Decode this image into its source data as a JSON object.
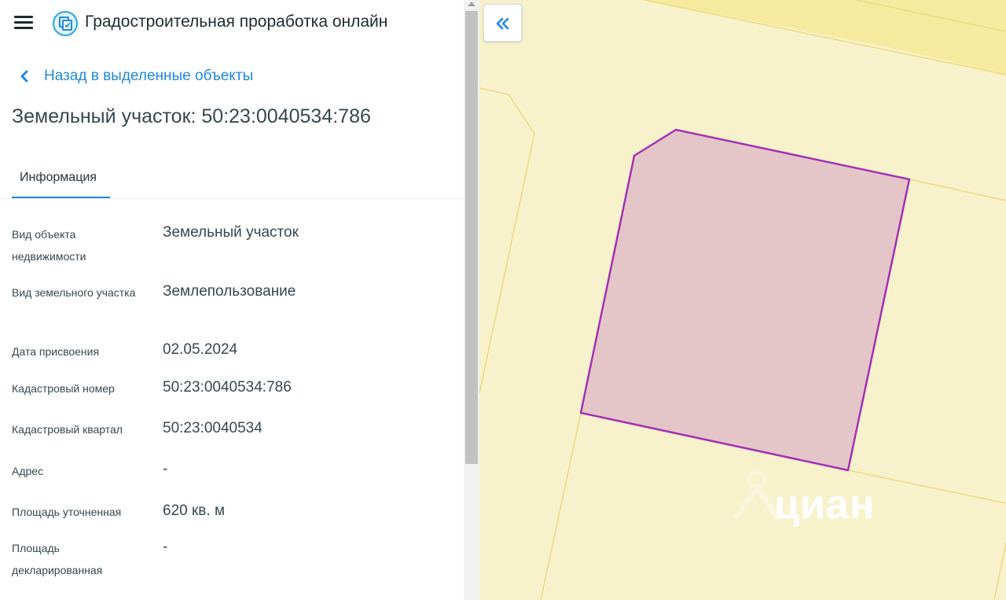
{
  "app": {
    "title": "Градостроительная проработка онлайн",
    "accent_color": "#1e88e5"
  },
  "nav": {
    "back_label": "Назад в выделенные объекты"
  },
  "page": {
    "title": "Земельный участок: 50:23:0040534:786"
  },
  "tabs": [
    {
      "label": "Информация",
      "active": true
    }
  ],
  "properties": [
    {
      "label": "Вид объекта недвижимости",
      "value": "Земельный участок"
    },
    {
      "label": "Вид земельного участка",
      "value": "Землепользование"
    },
    {
      "label": "Дата присвоения",
      "value": "02.05.2024"
    },
    {
      "label": "Кадастровый номер",
      "value": "50:23:0040534:786"
    },
    {
      "label": "Кадастровый квартал",
      "value": "50:23:0040534"
    },
    {
      "label": "Адрес",
      "value": "-"
    },
    {
      "label": "Площадь уточненная",
      "value": "620 кв. м"
    },
    {
      "label": "Площадь декларированная",
      "value": "-"
    }
  ],
  "map": {
    "background_color": "#f8f2cc",
    "parcel_fill": "#e4c6c8",
    "parcel_stroke": "#a331b4",
    "boundary_color": "#ecd97e",
    "watermark": "циан"
  },
  "icons": {
    "menu": "hamburger-icon",
    "logo": "app-logo-icon",
    "back": "chevron-left-icon",
    "collapse": "double-chevron-left-icon"
  }
}
